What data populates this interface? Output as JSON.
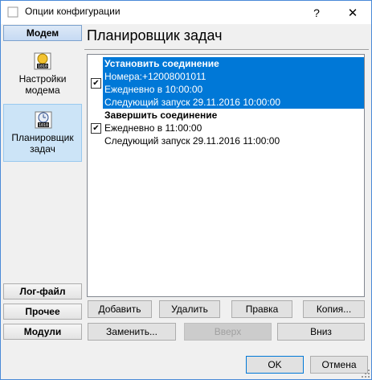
{
  "window": {
    "title": "Опции конфигурации",
    "help": "?",
    "close": "✕"
  },
  "left": {
    "modem_group": "Модем",
    "items": [
      {
        "label_line1": "Настройки",
        "label_line2": "модема"
      },
      {
        "label_line1": "Планировщик",
        "label_line2": "задач"
      }
    ],
    "log_group": "Лог-файл",
    "other_group": "Прочее",
    "modules_group": "Модули"
  },
  "main": {
    "title": "Планировщик задач",
    "tasks": [
      {
        "checked": true,
        "name": "Установить соединение",
        "numbers": "Номера:+12008001011",
        "schedule": "Ежедневно в 10:00:00",
        "next": "Следующий запуск 29.11.2016 10:00:00"
      },
      {
        "checked": true,
        "name": "Завершить соединение",
        "schedule": "Ежедневно в 11:00:00",
        "next": "Следующий запуск 29.11.2016 11:00:00"
      }
    ],
    "buttons": {
      "add": "Добавить",
      "delete": "Удалить",
      "edit": "Правка",
      "copy": "Копия...",
      "replace": "Заменить...",
      "up": "Вверх",
      "down": "Вниз"
    }
  },
  "footer": {
    "ok": "OK",
    "cancel": "Отмена"
  }
}
